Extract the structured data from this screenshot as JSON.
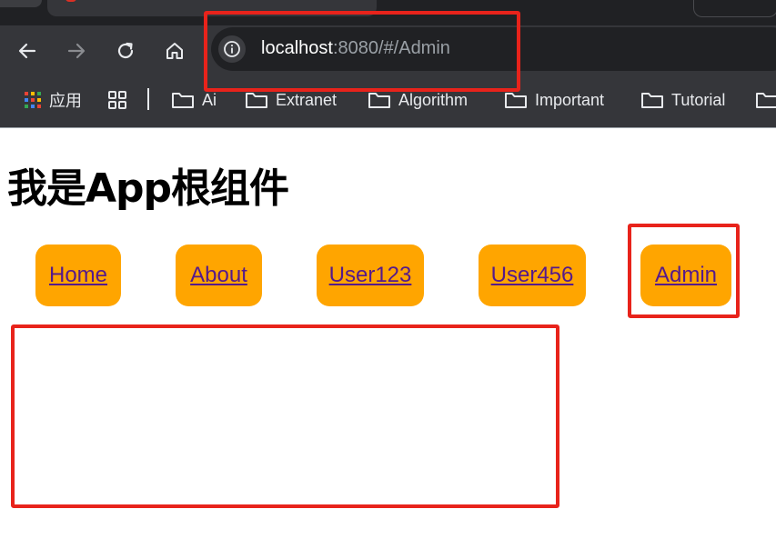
{
  "browser": {
    "url_host": "localhost",
    "url_rest": ":8080/#/Admin",
    "bookmarks": [
      {
        "label": "应用",
        "icon": "apps-grid-icon"
      },
      {
        "label": "",
        "icon": "tab-groups-icon"
      },
      {
        "label": "Ai",
        "icon": "folder-icon"
      },
      {
        "label": "Extranet",
        "icon": "folder-icon"
      },
      {
        "label": "Algorithm",
        "icon": "folder-icon"
      },
      {
        "label": "Important",
        "icon": "folder-icon"
      },
      {
        "label": "Tutorial",
        "icon": "folder-icon"
      }
    ]
  },
  "page": {
    "title": "我是App根组件",
    "nav_links": [
      "Home",
      "About",
      "User123",
      "User456",
      "Admin"
    ]
  },
  "colors": {
    "nav_bg": "#ffa500",
    "link_color": "#551a8b",
    "annotation": "#e8231b",
    "browser_chrome": "#35363a"
  }
}
